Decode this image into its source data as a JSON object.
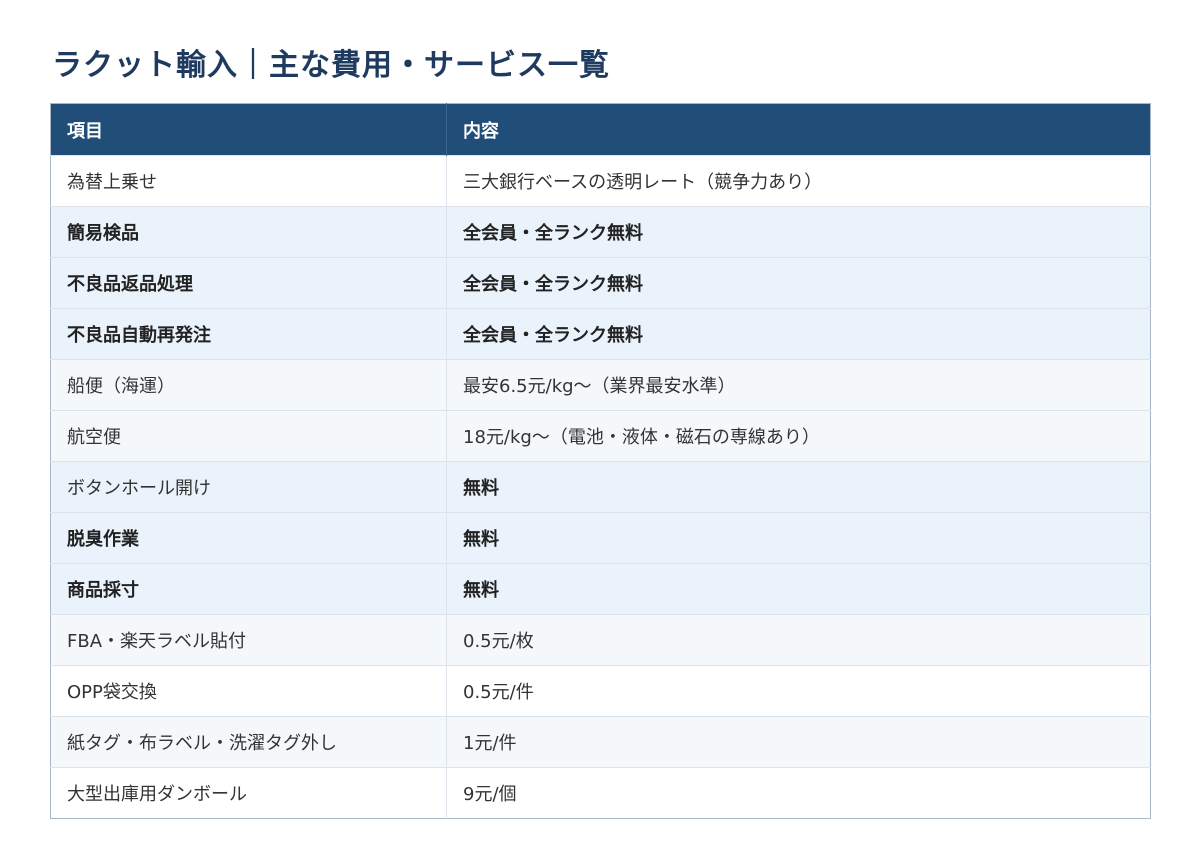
{
  "title": "ラクット輸入｜主な費用・サービス一覧",
  "table": {
    "headers": [
      "項目",
      "内容"
    ],
    "rows": [
      {
        "item": "為替上乗せ",
        "content": "三大銀行ベースの透明レート（競争力あり）",
        "style": "plain",
        "content_bold": false
      },
      {
        "item": "簡易検品",
        "content": "全会員・全ランク無料",
        "style": "hl",
        "content_bold": true
      },
      {
        "item": "不良品返品処理",
        "content": "全会員・全ランク無料",
        "style": "hl",
        "content_bold": true
      },
      {
        "item": "不良品自動再発注",
        "content": "全会員・全ランク無料",
        "style": "hl",
        "content_bold": true
      },
      {
        "item": "船便（海運）",
        "content": "最安6.5元/kg〜（業界最安水準）",
        "style": "alt",
        "content_bold": false
      },
      {
        "item": "航空便",
        "content": "18元/kg〜（電池・液体・磁石の専線あり）",
        "style": "alt",
        "content_bold": false
      },
      {
        "item": "ボタンホール開け",
        "content": "無料",
        "style": "hl-content",
        "content_bold": true
      },
      {
        "item": "脱臭作業",
        "content": "無料",
        "style": "hl",
        "content_bold": true
      },
      {
        "item": "商品採寸",
        "content": "無料",
        "style": "hl",
        "content_bold": true
      },
      {
        "item": "FBA・楽天ラベル貼付",
        "content": "0.5元/枚",
        "style": "alt",
        "content_bold": false
      },
      {
        "item": "OPP袋交換",
        "content": "0.5元/件",
        "style": "plain",
        "content_bold": false
      },
      {
        "item": "紙タグ・布ラベル・洗濯タグ外し",
        "content": "1元/件",
        "style": "alt",
        "content_bold": false
      },
      {
        "item": "大型出庫用ダンボール",
        "content": "9元/個",
        "style": "plain",
        "content_bold": false
      }
    ]
  },
  "colors": {
    "title": "#1f3a5f",
    "header_bg": "#214e78",
    "highlight_row_bg": "#eaf3fc",
    "alt_row_bg": "#f5f8fb"
  }
}
